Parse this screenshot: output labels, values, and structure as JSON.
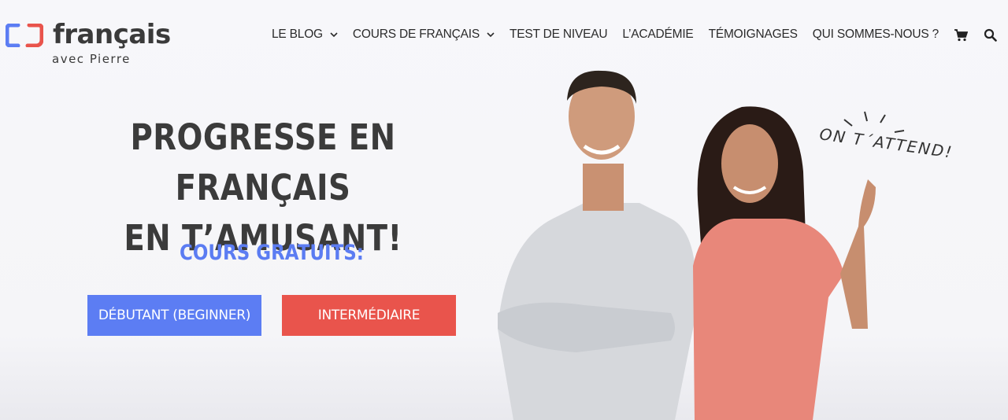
{
  "brand": {
    "name": "français",
    "tagline": "avec Pierre",
    "colors": {
      "blue": "#5c7df3",
      "red": "#e9544c"
    }
  },
  "nav": {
    "items": [
      {
        "label": "LE BLOG",
        "has_dropdown": true
      },
      {
        "label": "COURS DE FRANÇAIS",
        "has_dropdown": true
      },
      {
        "label": "TEST DE NIVEAU",
        "has_dropdown": false
      },
      {
        "label": "L’ACADÉMIE",
        "has_dropdown": false
      },
      {
        "label": "TÉMOIGNAGES",
        "has_dropdown": false
      },
      {
        "label": "QUI SOMMES-NOUS ?",
        "has_dropdown": false
      }
    ],
    "icons": [
      "cart-icon",
      "search-icon"
    ]
  },
  "hero": {
    "title_line1": "PROGRESSE EN FRANÇAIS",
    "title_line2": "EN T’AMUSANT!",
    "subtitle": "COURS GRATUITS:",
    "button_beginner": "DÉBUTANT (BEGINNER)",
    "button_intermediate": "INTERMÉDIAIRE",
    "handwritten_note": "ON T´ATTEND!"
  }
}
